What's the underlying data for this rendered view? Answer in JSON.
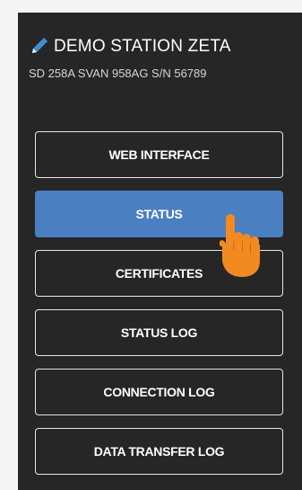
{
  "header": {
    "title": "DEMO STATION ZETA",
    "subtitle": "SD 258A SVAN 958AG S/N 56789",
    "edit_icon": "pencil-icon"
  },
  "menu": {
    "items": [
      {
        "label": "WEB INTERFACE",
        "active": false
      },
      {
        "label": "STATUS",
        "active": true
      },
      {
        "label": "CERTIFICATES",
        "active": false
      },
      {
        "label": "STATUS LOG",
        "active": false
      },
      {
        "label": "CONNECTION LOG",
        "active": false
      },
      {
        "label": "DATA TRANSFER LOG",
        "active": false
      }
    ]
  },
  "cursor_icon": "hand-pointer-icon",
  "colors": {
    "panel_background": "#262626",
    "active_button": "#4a80c2",
    "button_border": "#e6e6e6",
    "pencil": "#3f8fd6",
    "hand_cursor": "#f28a21"
  }
}
